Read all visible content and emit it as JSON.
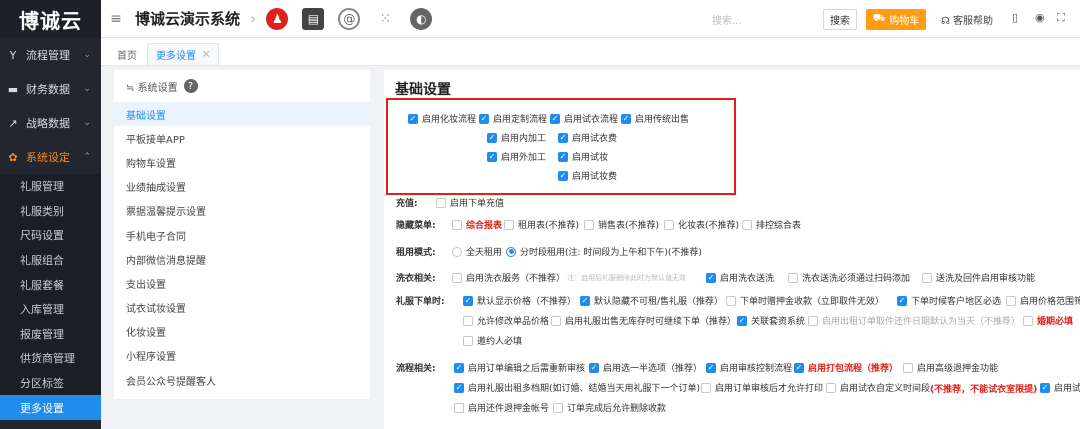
{
  "brand": {
    "logo": "博诚云"
  },
  "sidebar": {
    "groups": [
      {
        "label": "流程管理",
        "icon": "Y"
      },
      {
        "label": "财务数据",
        "icon": "▬"
      },
      {
        "label": "战略数据",
        "icon": "↗"
      },
      {
        "label": "系统设定",
        "icon": "✿"
      }
    ],
    "items": [
      "礼服管理",
      "礼服类别",
      "尺码设置",
      "礼服组合",
      "礼服套餐",
      "入库管理",
      "报废管理",
      "供货商管理",
      "分区标签",
      "更多设置"
    ]
  },
  "topbar": {
    "menu_icon": "≡",
    "title": "博诚云演示系统",
    "search_placeholder": "搜索...",
    "search_button": "搜索",
    "cart_button": "购物车",
    "help": "客服帮助"
  },
  "tabs": [
    {
      "label": "首页"
    },
    {
      "label": "更多设置"
    }
  ],
  "settings_panel": {
    "header": "≒ 系统设置",
    "items": [
      "基础设置",
      "平板接单APP",
      "购物车设置",
      "业绩抽成设置",
      "票据温馨提示设置",
      "手机电子合同",
      "内部微信消息提醒",
      "支出设置",
      "试衣试妆设置",
      "化妆设置",
      "小程序设置",
      "会员公众号提醒客人"
    ]
  },
  "main": {
    "title": "基础设置",
    "process": {
      "row1": [
        "启用化妆流程",
        "启用定制流程",
        "启用试衣流程",
        "启用传统出售"
      ],
      "col2": [
        "启用内加工",
        "启用外加工"
      ],
      "col3": [
        "启用试衣费",
        "启用试妆",
        "启用试妆费"
      ]
    },
    "recharge": {
      "label": "充值:",
      "option": "启用下单充值"
    },
    "hidden_menu": {
      "label": "隐藏菜单:",
      "options": [
        "综合报表",
        "租用表(不推荐)",
        "销售表(不推荐)",
        "化妆表(不推荐)",
        "排控综合表"
      ]
    },
    "rent_mode": {
      "label": "租用模式:",
      "options": [
        "全天租用",
        "分时段租用(注: 时间段为上午和下午)(不推荐)"
      ]
    },
    "washing": {
      "label": "洗衣相关:",
      "opt1": "启用洗衣服务（不推荐）",
      "note": "注：启用后礼服删除此时为默认值无效",
      "opt2": "启用洗衣送洗",
      "opt3": "洗衣送洗必须通过扫码添加",
      "opt4": "送洗及回件启用审核功能"
    },
    "dress_order": {
      "label": "礼服下单时:",
      "row1": [
        "默认显示价格（不推荐）",
        "默认隐藏不可租/售礼服（推荐）",
        "下单时赠押金收款（立即取件无效）",
        "下单时候客户地区必选",
        "启用价格范围筛"
      ],
      "row2": [
        "允许修改单品价格",
        "启用礼服出售无库存时可继续下单（推荐）",
        "关联套资系统",
        "启用出租订单取件还件日期默认为当天（不推荐）",
        "婚期必填"
      ],
      "row3": [
        "邀约人必填"
      ]
    },
    "flow": {
      "label": "流程相关:",
      "row1": [
        "启用订单编辑之后需重新审核",
        "启用选一半选项（推荐）",
        "启用审核控制流程",
        "启用打包流程（推荐）",
        "启用高级退押金功能"
      ],
      "row2": [
        "启用礼服出租多档期(如订婚、结婚当天用礼服下一个订单)",
        "启用订单审核后才允许打印",
        "启用试衣自定义时间段",
        "(不推荐，不能试衣室限提)",
        "启用试"
      ],
      "row3": [
        "启用还件退押金帐号",
        "订单完成后允许删除收款"
      ]
    }
  }
}
